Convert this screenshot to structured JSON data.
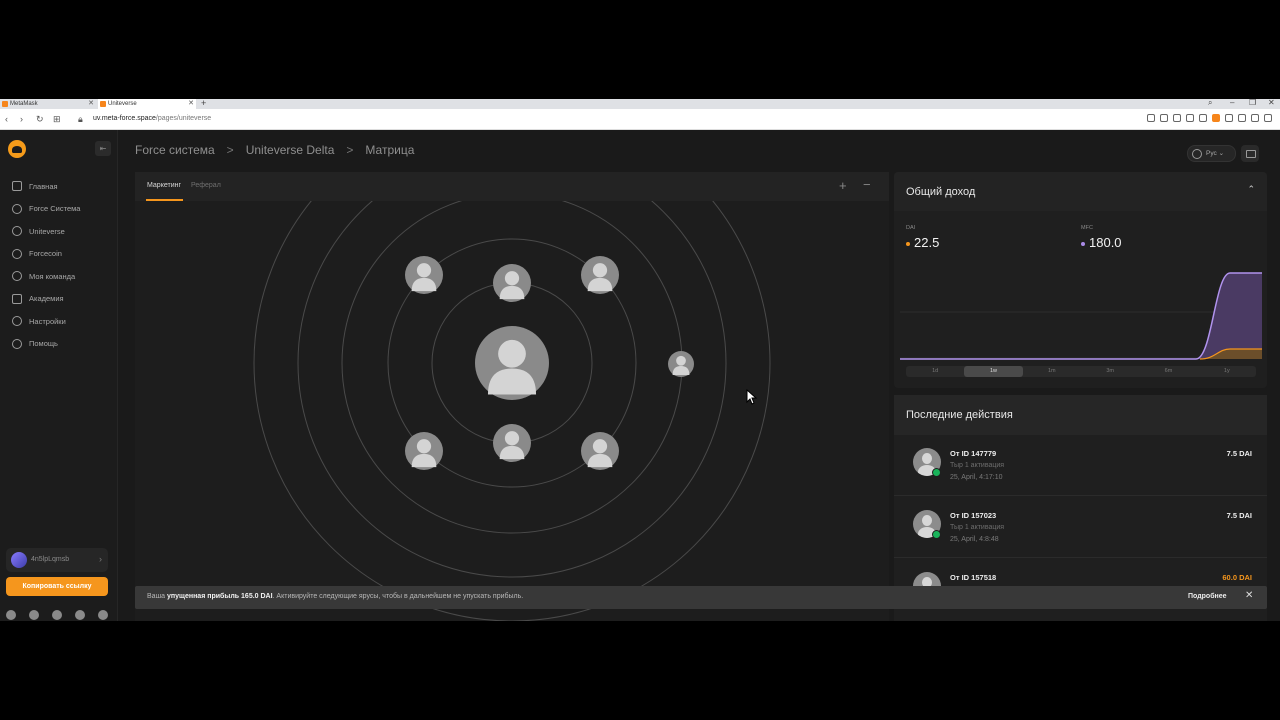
{
  "browser": {
    "tabs": [
      {
        "title": "MetaMask",
        "active": false
      },
      {
        "title": "Uniteverse",
        "active": true
      }
    ],
    "url_domain": "uv.meta-force.space",
    "url_path": "/pages/uniteverse"
  },
  "sidebar": {
    "items": [
      {
        "label": "Главная",
        "icon": "home-icon"
      },
      {
        "label": "Force Система",
        "icon": "sun-icon"
      },
      {
        "label": "Uniteverse",
        "icon": "sun-icon"
      },
      {
        "label": "Forcecoin",
        "icon": "coin-icon"
      },
      {
        "label": "Моя команда",
        "icon": "team-icon"
      },
      {
        "label": "Академия",
        "icon": "academy-icon"
      },
      {
        "label": "Настройки",
        "icon": "settings-icon"
      },
      {
        "label": "Помощь",
        "icon": "help-icon"
      }
    ],
    "user_name": "4n5lpLqmsb",
    "copy_link_label": "Копировать ссылку"
  },
  "breadcrumb": {
    "items": [
      "Force система",
      "Uniteverse Delta",
      "Матрица"
    ],
    "separator": ">"
  },
  "header": {
    "lang_label": "Рус"
  },
  "matrix": {
    "tabs": [
      "Маркетинг",
      "Реферал"
    ],
    "zoom_in": "+",
    "zoom_out": "−"
  },
  "income": {
    "title": "Общий доход",
    "dai_label": "DAI",
    "dai_value": "22.5",
    "mfc_label": "MFC",
    "mfc_value": "180.0",
    "ranges": [
      "1d",
      "1w",
      "1m",
      "3m",
      "6m",
      "1y"
    ],
    "active_range": "1w",
    "colors": {
      "dai": "#f5961d",
      "mfc": "#a98ae6"
    }
  },
  "activity": {
    "title": "Последние действия",
    "items": [
      {
        "id": "От ID 147779",
        "desc": "Тыр 1 активация",
        "time": "25, April, 4:17:10",
        "amount": "7.5 DAI",
        "highlight": false
      },
      {
        "id": "От ID 157023",
        "desc": "Тыр 1 активация",
        "time": "25, April, 4:8:48",
        "amount": "7.5 DAI",
        "highlight": false
      },
      {
        "id": "От ID 157518",
        "desc": "",
        "time": "",
        "amount": "60.0 DAI",
        "highlight": true
      }
    ]
  },
  "notice": {
    "prefix": "Ваша",
    "bold_part": "упущенная прибыль 165.0 DAI",
    "suffix": ". Активируйте следующие ярусы, чтобы в дальнейшем не упускать прибыль.",
    "more_label": "Подробнее"
  }
}
